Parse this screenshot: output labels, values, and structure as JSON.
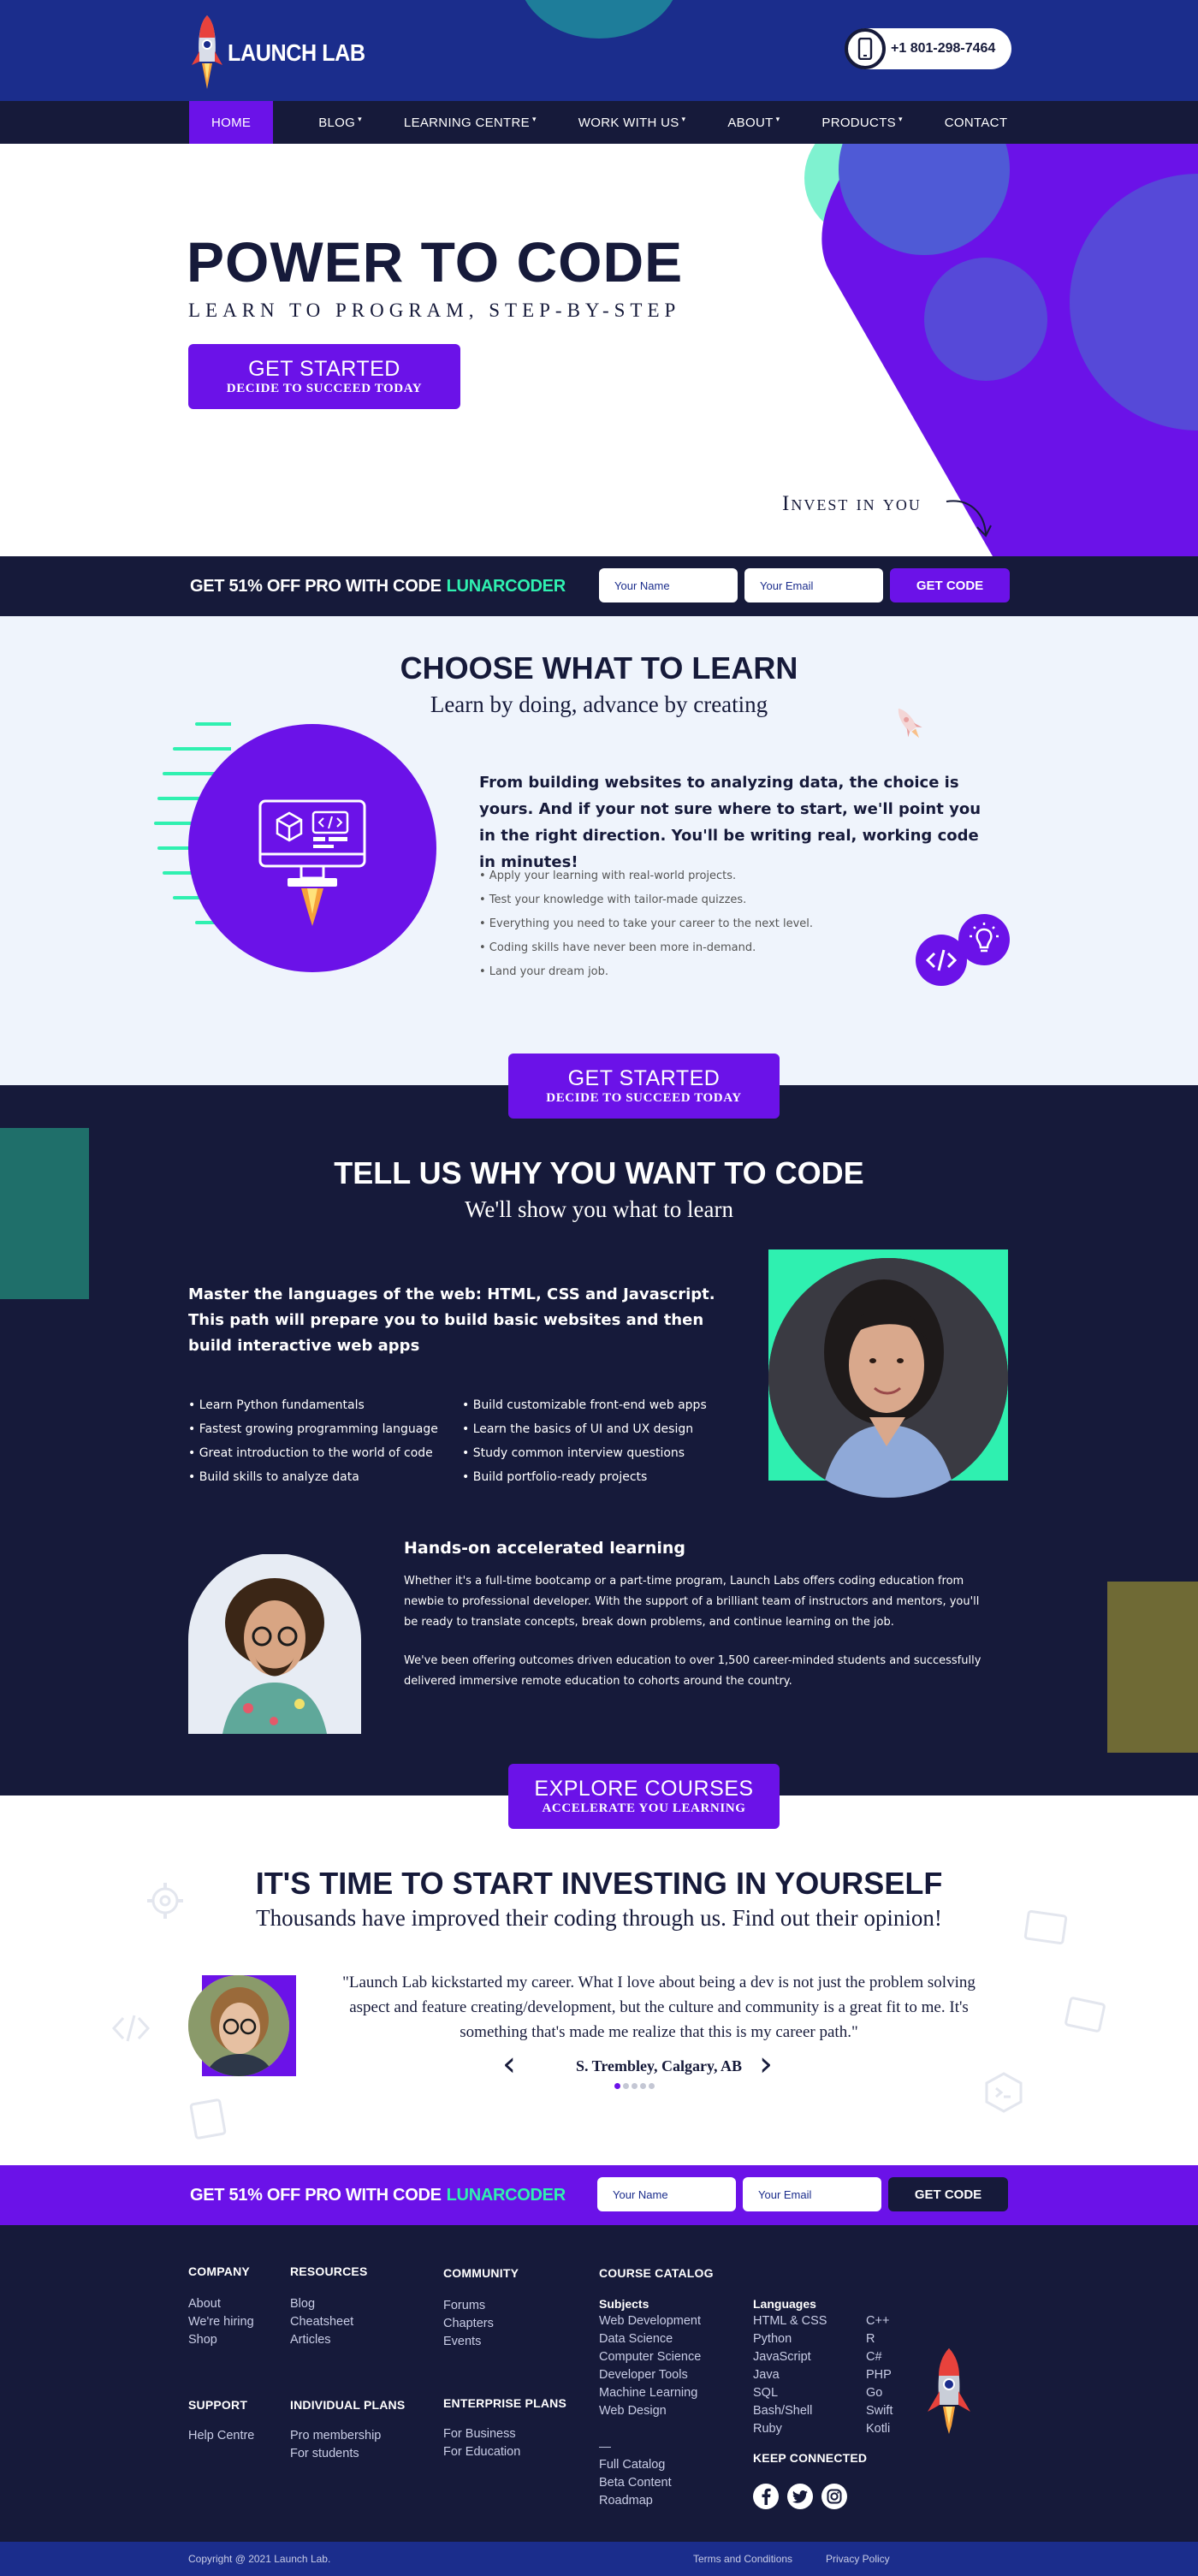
{
  "header": {
    "logo_text": "LAUNCH LAB",
    "phone": "+1 801-298-7464"
  },
  "nav": {
    "items": [
      {
        "label": "HOME",
        "caret": false
      },
      {
        "label": "BLOG",
        "caret": true
      },
      {
        "label": "LEARNING CENTRE",
        "caret": true
      },
      {
        "label": "WORK WITH US",
        "caret": true
      },
      {
        "label": "ABOUT",
        "caret": true
      },
      {
        "label": "PRODUCTS",
        "caret": true
      },
      {
        "label": "CONTACT",
        "caret": false
      }
    ],
    "caret_glyph": "▾"
  },
  "hero": {
    "title": "POWER TO CODE",
    "subtitle": "LEARN TO PROGRAM, STEP-BY-STEP",
    "cta_line1": "GET STARTED",
    "cta_line2": "DECIDE TO SUCCEED TODAY",
    "invest_text": "Invest in you"
  },
  "promo": {
    "text": "GET 51% OFF PRO WITH CODE",
    "code": "LUNARCODER",
    "name_placeholder": "Your Name",
    "email_placeholder": "Your Email",
    "button": "GET CODE"
  },
  "choose": {
    "title": "CHOOSE WHAT TO LEARN",
    "subtitle": "Learn by doing, advance by creating",
    "lead": "From building websites to analyzing data, the choice is yours. And if your not sure where to start, we'll point you in the right direction. You'll be writing real, working code in minutes!",
    "bullets": [
      "• Apply your learning with real-world projects.",
      "• Test your knowledge with tailor-made quizzes.",
      "• Everything you need to take your career to the next level.",
      "• Coding skills have never been more in-demand.",
      "• Land your dream job."
    ],
    "cta_line1": "GET STARTED",
    "cta_line2": "DECIDE TO SUCCEED TODAY"
  },
  "why": {
    "title": "TELL US WHY YOU WANT TO CODE",
    "subtitle": "We'll show you what to learn",
    "lead": "Master the languages of the web: HTML, CSS and Javascript. This path will prepare you to build basic websites and then build interactive web apps",
    "bullets_left": [
      "• Learn Python fundamentals",
      "• Fastest growing programming language",
      "• Great introduction to the world of code",
      "• Build skills to analyze data"
    ],
    "bullets_right": [
      "• Build customizable front-end web apps",
      "• Learn the basics of UI and UX design",
      "• Study common interview questions",
      "• Build portfolio-ready projects"
    ],
    "hands_title": "Hands-on accelerated learning",
    "para1": "Whether it's a full-time bootcamp or a part-time program, Launch Labs offers coding education from newbie to professional developer. With the support of a brilliant team of instructors and mentors, you'll be ready to translate concepts, break down problems, and continue learning on the job.",
    "para2": "We've been offering outcomes driven education to over 1,500 career-minded students and successfully delivered immersive remote education to cohorts around the country.",
    "cta_line1": "EXPLORE COURSES",
    "cta_line2": "ACCELERATE YOU LEARNING"
  },
  "testimonials": {
    "title": "IT'S TIME TO START INVESTING IN YOURSELF",
    "subtitle": "Thousands have improved their coding through us. Find out their opinion!",
    "quote": "\"Launch Lab kickstarted my career. What I love about being a dev is not just the problem solving aspect and feature creating/development, but the culture and community is a great fit to me. It's something that's made me realize that this is my career path.\"",
    "author": "S. Trembley, Calgary, AB",
    "prev_glyph": "‹",
    "next_glyph": "›",
    "dots": 5,
    "active_dot": 0
  },
  "footer": {
    "company": {
      "title": "COMPANY",
      "links": [
        "About",
        "We're hiring",
        "Shop"
      ]
    },
    "resources": {
      "title": "RESOURCES",
      "links": [
        "Blog",
        "Cheatsheet",
        "Articles"
      ]
    },
    "community": {
      "title": "COMMUNITY",
      "links": [
        "Forums",
        "Chapters",
        "Events"
      ]
    },
    "catalog": {
      "title": "COURSE CATALOG",
      "subjects_title": "Subjects",
      "subjects": [
        "Web Development",
        "Data Science",
        "Computer Science",
        "Developer Tools",
        "Machine Learning",
        "Web Design"
      ],
      "languages_title": "Languages",
      "languages_a": [
        "HTML & CSS",
        "Python",
        "JavaScript",
        "Java",
        "SQL",
        "Bash/Shell",
        "Ruby"
      ],
      "languages_b": [
        "C++",
        "R",
        "C#",
        "PHP",
        "Go",
        "Swift",
        "Kotli"
      ],
      "dash": "—",
      "extra": [
        "Full Catalog",
        "Beta Content",
        "Roadmap"
      ]
    },
    "support": {
      "title": "SUPPORT",
      "links": [
        "Help Centre"
      ]
    },
    "individual": {
      "title": "INDIVIDUAL PLANS",
      "links": [
        "Pro membership",
        "For students"
      ]
    },
    "enterprise": {
      "title": "ENTERPRISE PLANS",
      "links": [
        "For Business",
        "For Education"
      ]
    },
    "keep_connected": "KEEP CONNECTED",
    "copyright": "Copyright @ 2021 Launch Lab.",
    "terms": "Terms and Conditions",
    "privacy": "Privacy Policy"
  },
  "colors": {
    "navy": "#161a3a",
    "royal": "#1b2d8c",
    "purple": "#6b12e8",
    "mint": "#2ff0b0",
    "olive": "#6f6a35",
    "teal": "#1f6f6a",
    "light": "#eff4fc"
  }
}
